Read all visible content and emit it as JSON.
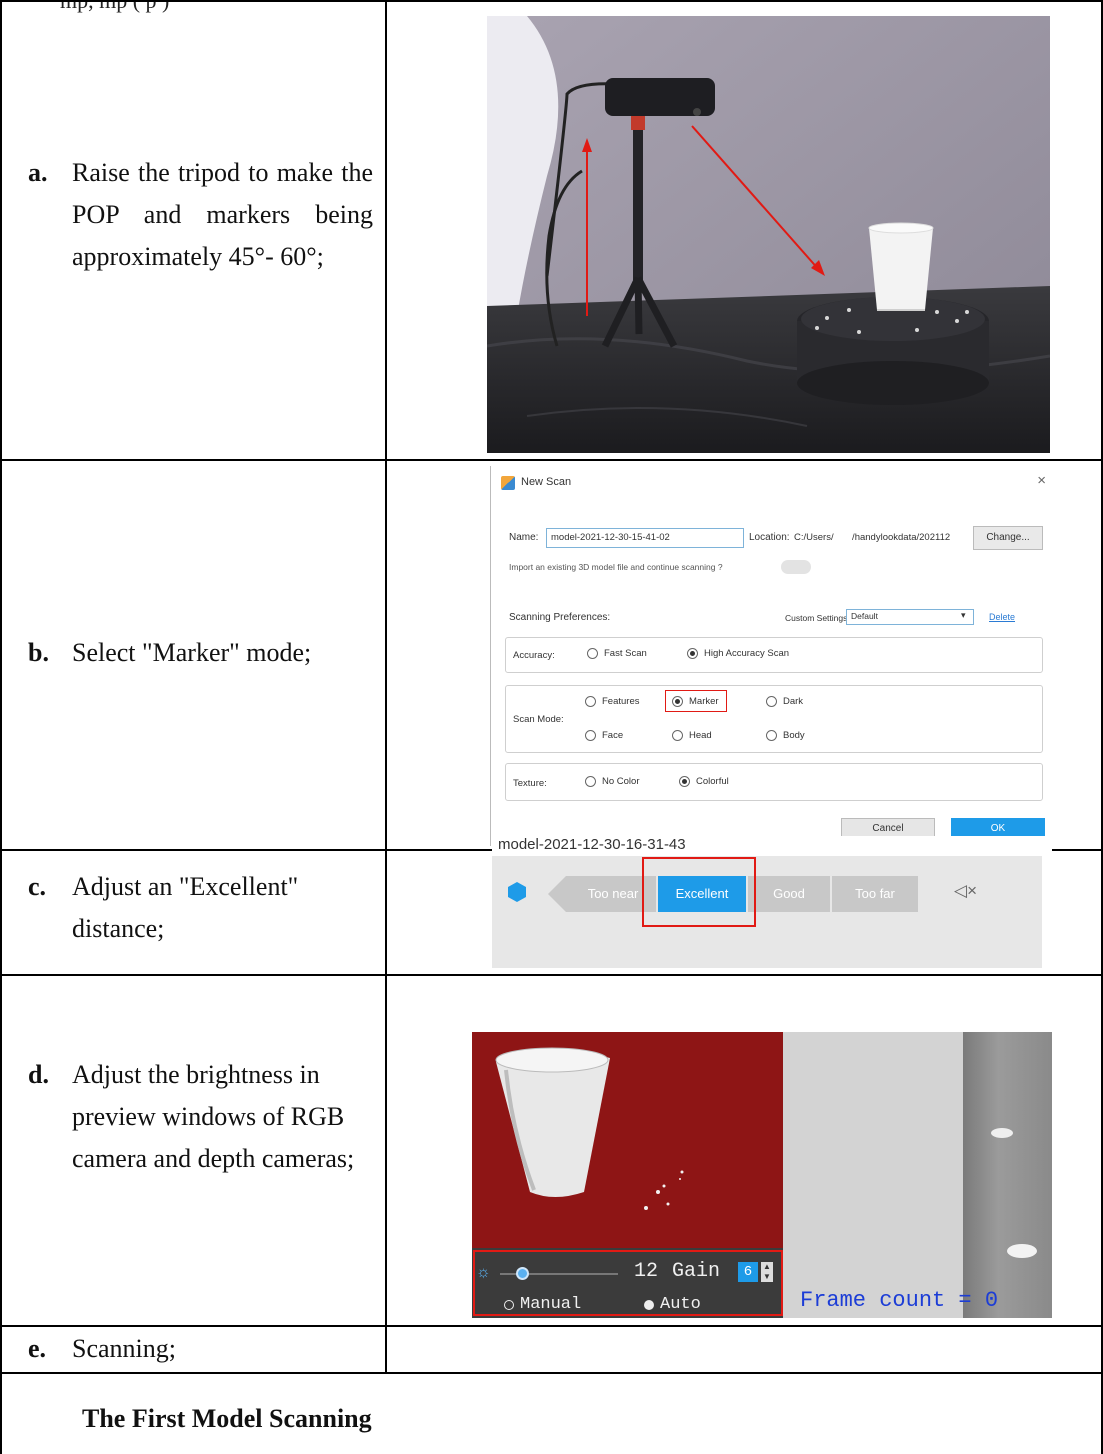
{
  "table": {
    "row_a": {
      "letter": "a.",
      "text": "Raise the tripod to make the POP and markers being approximately 45°- 60°;"
    },
    "row_b": {
      "letter": "b.",
      "text": "Select \"Marker\" mode;"
    },
    "row_c": {
      "letter": "c.",
      "text": "Adjust an \"Excellent\" distance;"
    },
    "row_d": {
      "letter": "d.",
      "text": "Adjust the brightness in preview windows of RGB camera and depth cameras;"
    },
    "row_e": {
      "letter": "e.",
      "text": "Scanning;"
    }
  },
  "new_scan_dialog": {
    "title": "New Scan",
    "close": "×",
    "name_label": "Name:",
    "name_value": "model-2021-12-30-15-41-02",
    "location_label": "Location:",
    "location_value": "C:/Users/       /handylookdata/202112",
    "change_button": "Change...",
    "import_text": "Import an existing 3D model file and continue scanning ?",
    "prefs_label": "Scanning Preferences:",
    "custom_settings_label": "Custom Settings:",
    "custom_settings_value": "Default",
    "delete_link": "Delete",
    "accuracy_label": "Accuracy:",
    "accuracy_options": [
      "Fast Scan",
      "High Accuracy Scan"
    ],
    "scan_mode_label": "Scan Mode:",
    "scan_mode_row1": [
      "Features",
      "Marker",
      "Dark"
    ],
    "scan_mode_row2": [
      "Face",
      "Head",
      "Body"
    ],
    "texture_label": "Texture:",
    "texture_options": [
      "No Color",
      "Colorful"
    ],
    "cancel_button": "Cancel",
    "ok_button": "OK"
  },
  "distance_bar": {
    "model_name": "model-2021-12-30-16-31-43",
    "segments": [
      "Too near",
      "Excellent",
      "Good",
      "Too far"
    ],
    "active_color": "#1e9be8",
    "inactive_color": "#c8c8c8",
    "mute_icon_text": "◁×"
  },
  "preview": {
    "exposure_value": "12",
    "gain_label": "Gain",
    "gain_value": "6",
    "manual_label": "Manual",
    "auto_label": "Auto",
    "frame_count_text": "Frame count = 0",
    "depth_bg": "#8e1515"
  },
  "caption": "The First Model Scanning"
}
